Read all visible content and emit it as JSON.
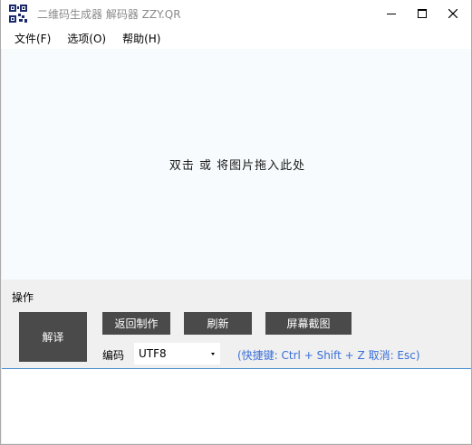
{
  "window": {
    "title": "二维码生成器 解码器 ZZY.QR"
  },
  "menu": {
    "items": [
      {
        "label": "文件(F)"
      },
      {
        "label": "选项(O)"
      },
      {
        "label": "帮助(H)"
      }
    ]
  },
  "dropzone": {
    "hint": "双击 或 将图片拖入此处"
  },
  "operations": {
    "group_label": "操作",
    "decode_label": "解译",
    "back_label": "返回制作",
    "refresh_label": "刷新",
    "capture_label": "屏幕截图",
    "encoding_label": "编码",
    "encoding_value": "UTF8",
    "hotkey_hint": "(快捷键: Ctrl + Shift + Z  取消: Esc)"
  },
  "output": {
    "text": ""
  },
  "icons": {
    "app": "qr-code-icon",
    "minimize": "minimize-icon",
    "maximize": "maximize-icon",
    "close": "close-icon",
    "dropdown": "chevron-down-icon"
  },
  "colors": {
    "button_bg": "#4a4a4a",
    "button_text": "#ffffff",
    "hint_blue": "#3a6fd8",
    "dropzone_bg": "#f7fbfd",
    "output_border": "#4d8fd0"
  }
}
